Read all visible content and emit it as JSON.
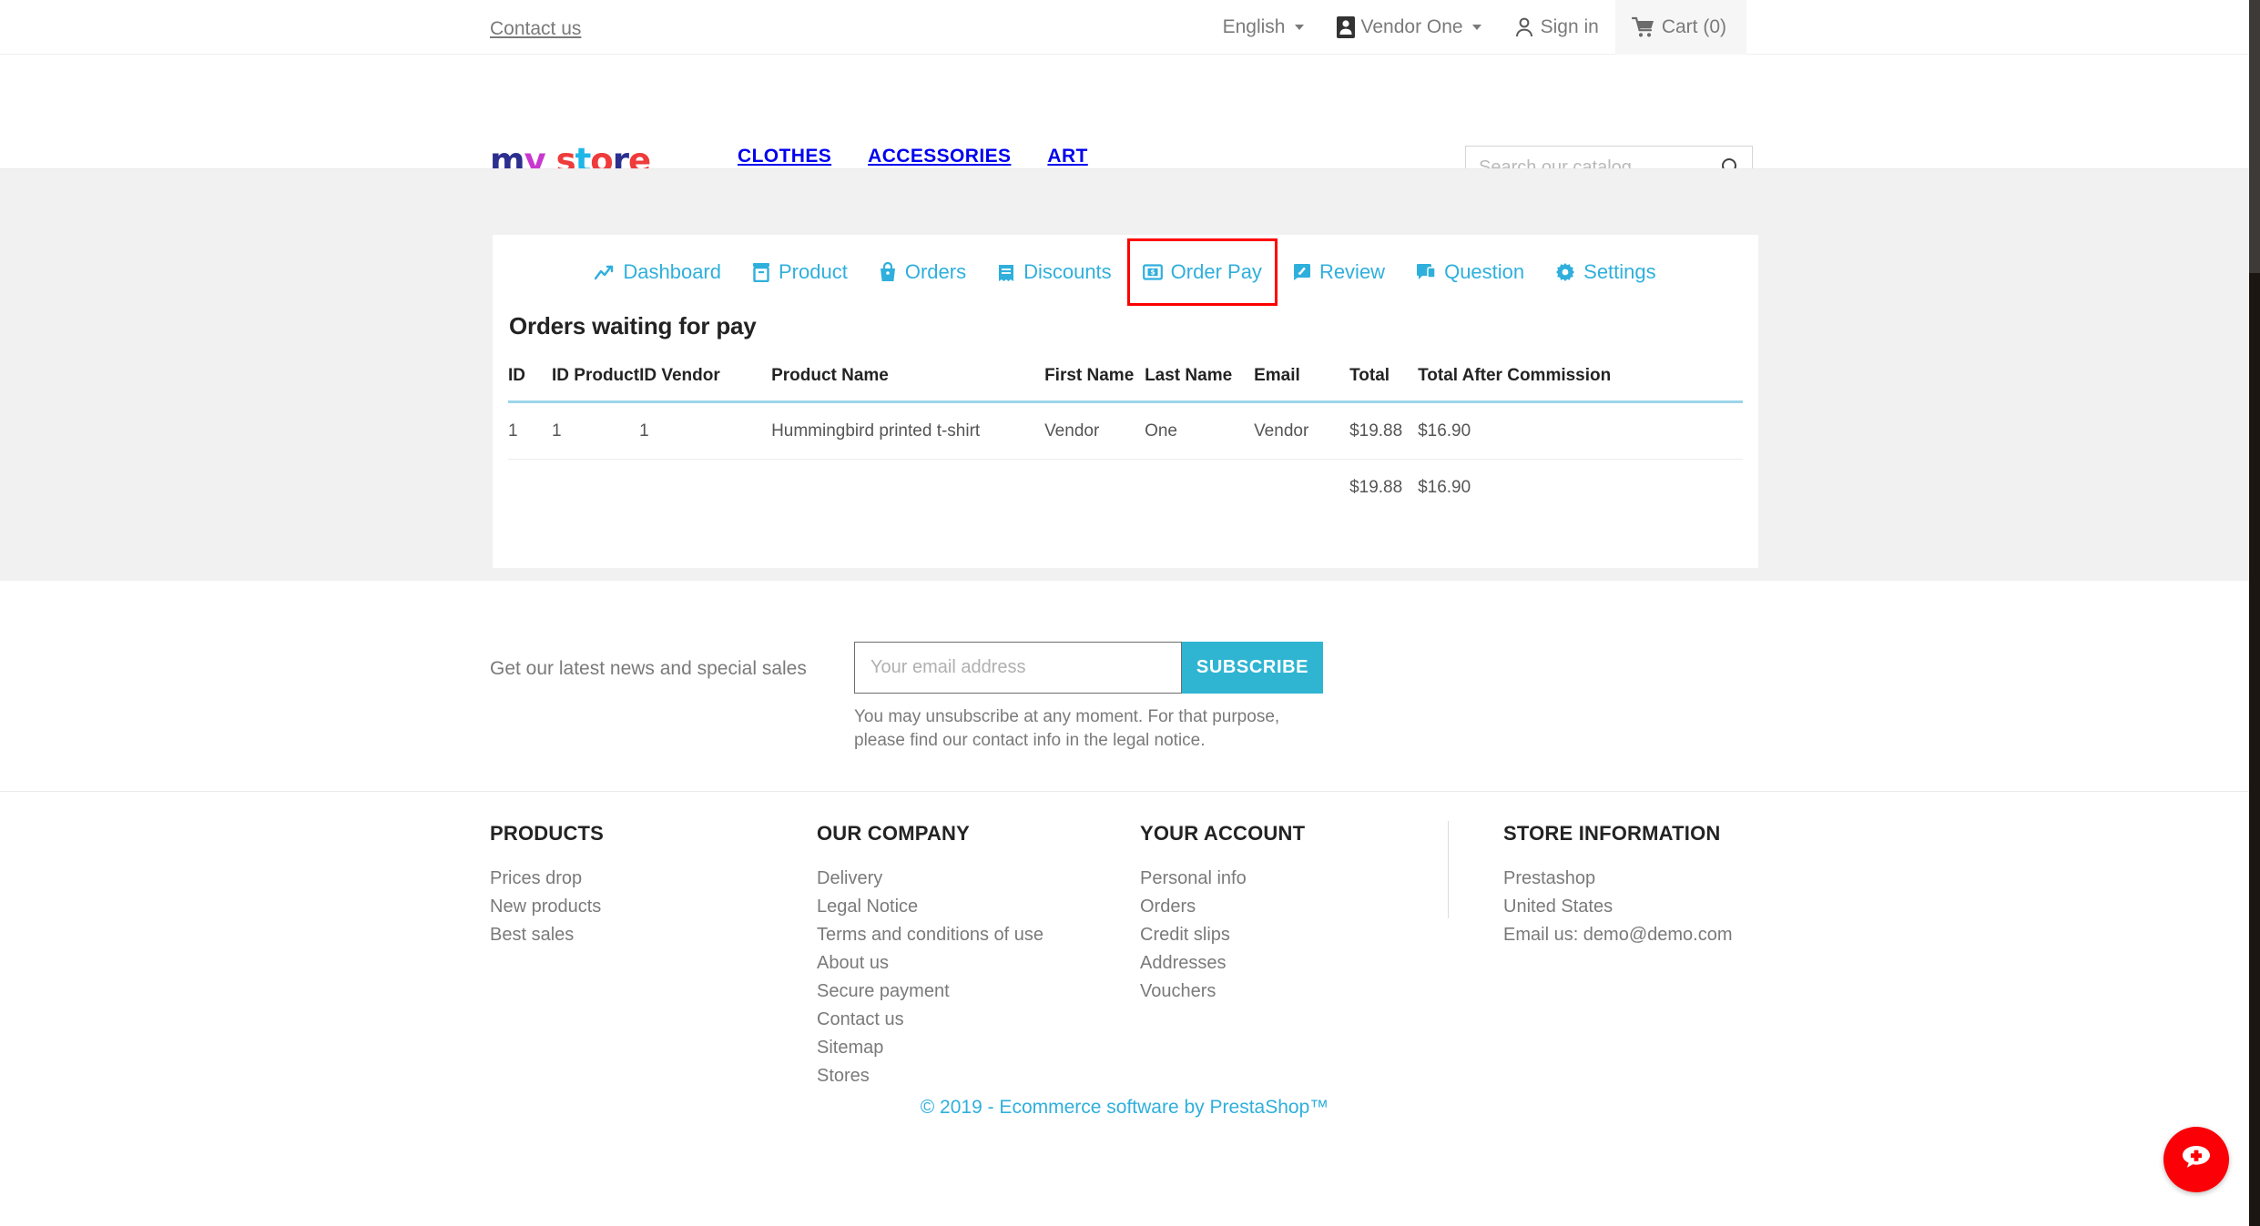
{
  "topnav": {
    "contact": "Contact us",
    "language": "English",
    "vendor": "Vendor One",
    "signin": "Sign in",
    "cart": "Cart (0)"
  },
  "header": {
    "logo": "my store",
    "menu": [
      "CLOTHES",
      "ACCESSORIES",
      "ART"
    ],
    "search_placeholder": "Search our catalog",
    "search_value": ""
  },
  "tabs": [
    {
      "label": "Dashboard",
      "icon": "trend-up-icon",
      "active": false
    },
    {
      "label": "Product",
      "icon": "box-icon",
      "active": false
    },
    {
      "label": "Orders",
      "icon": "bag-icon",
      "active": false
    },
    {
      "label": "Discounts",
      "icon": "ticket-icon",
      "active": false
    },
    {
      "label": "Order Pay",
      "icon": "money-bill-icon",
      "active": true
    },
    {
      "label": "Review",
      "icon": "review-icon",
      "active": false
    },
    {
      "label": "Question",
      "icon": "comment-icon",
      "active": false
    },
    {
      "label": "Settings",
      "icon": "gear-icon",
      "active": false
    }
  ],
  "main": {
    "section_title": "Orders waiting for pay",
    "columns": [
      "ID",
      "ID Product",
      "ID Vendor",
      "Product Name",
      "First Name",
      "Last Name",
      "Email",
      "Total",
      "Total After Commission"
    ],
    "rows": [
      {
        "id": "1",
        "id_product": "1",
        "id_vendor": "1",
        "product_name": "Hummingbird printed t-shirt",
        "first_name": "Vendor",
        "last_name": "One",
        "email": "Vendor",
        "total": "$19.88",
        "total_after_commission": "$16.90"
      }
    ],
    "totals": {
      "total": "$19.88",
      "total_after_commission": "$16.90"
    }
  },
  "newsletter": {
    "label": "Get our latest news and special sales",
    "placeholder": "Your email address",
    "value": "",
    "button": "SUBSCRIBE",
    "note_line1": "You may unsubscribe at any moment. For that purpose,",
    "note_line2": "please find our contact info in the legal notice."
  },
  "footer": {
    "products": {
      "title": "PRODUCTS",
      "links": [
        "Prices drop",
        "New products",
        "Best sales"
      ]
    },
    "company": {
      "title": "OUR COMPANY",
      "links": [
        "Delivery",
        "Legal Notice",
        "Terms and conditions of use",
        "About us",
        "Secure payment",
        "Contact us",
        "Sitemap",
        "Stores"
      ]
    },
    "account": {
      "title": "YOUR ACCOUNT",
      "links": [
        "Personal info",
        "Orders",
        "Credit slips",
        "Addresses",
        "Vouchers"
      ]
    },
    "store": {
      "title": "STORE INFORMATION",
      "lines": [
        "Prestashop",
        "United States",
        "Email us: demo@demo.com"
      ]
    },
    "copyright": "© 2019 - Ecommerce software by PrestaShop™"
  },
  "fab": {
    "icon": "chat-plus-icon"
  },
  "colors": {
    "accent": "#2fb5d2",
    "tab_link": "#2fafdc",
    "highlight_border": "#ff0000",
    "fab_bg": "#fb0007",
    "band_bg": "#f1f1f1"
  }
}
